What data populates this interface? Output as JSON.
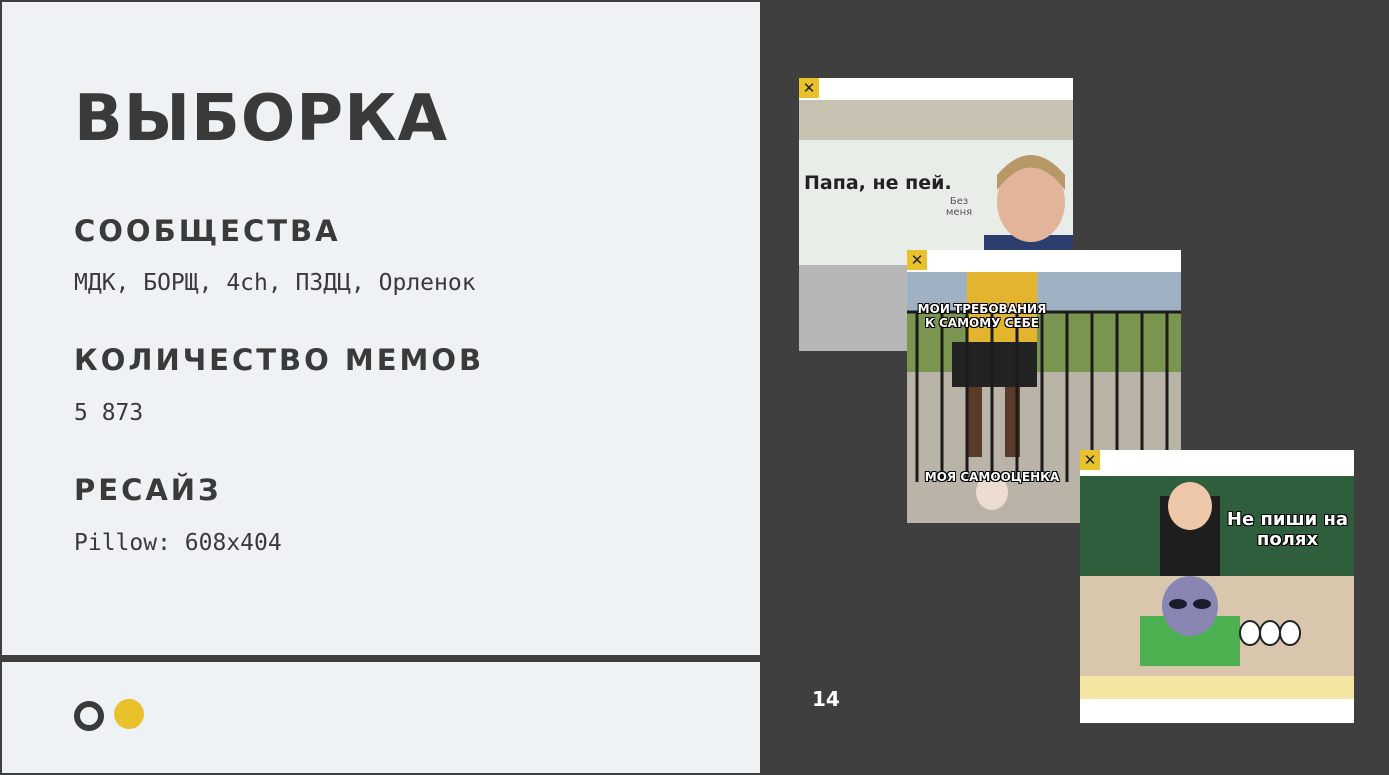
{
  "slide": {
    "title": "ВЫБОРКА",
    "page_number": "14",
    "sections": [
      {
        "heading": "СООБЩЕСТВА",
        "value": "МДК, БОРЩ, 4ch, ПЗДЦ, Орленок"
      },
      {
        "heading": "КОЛИЧЕСТВО МЕМОВ",
        "value": "5 873"
      },
      {
        "heading": "РЕСАЙЗ",
        "value": "Pillow: 608x404"
      }
    ]
  },
  "memes": [
    {
      "close_glyph": "✕",
      "caption": "Папа, не пей.",
      "scribble": "Без меня"
    },
    {
      "close_glyph": "✕",
      "caption_top": "МОИ ТРЕБОВАНИЯ К САМОМУ СЕБЕ",
      "caption_bottom": "МОЯ САМООЦЕНКА"
    },
    {
      "close_glyph": "✕",
      "caption": "Не пиши на полях"
    }
  ],
  "colors": {
    "accent": "#e8c12b",
    "dark": "#3f3f3f",
    "panel": "#eef2f5",
    "text": "#3a3a3a"
  }
}
